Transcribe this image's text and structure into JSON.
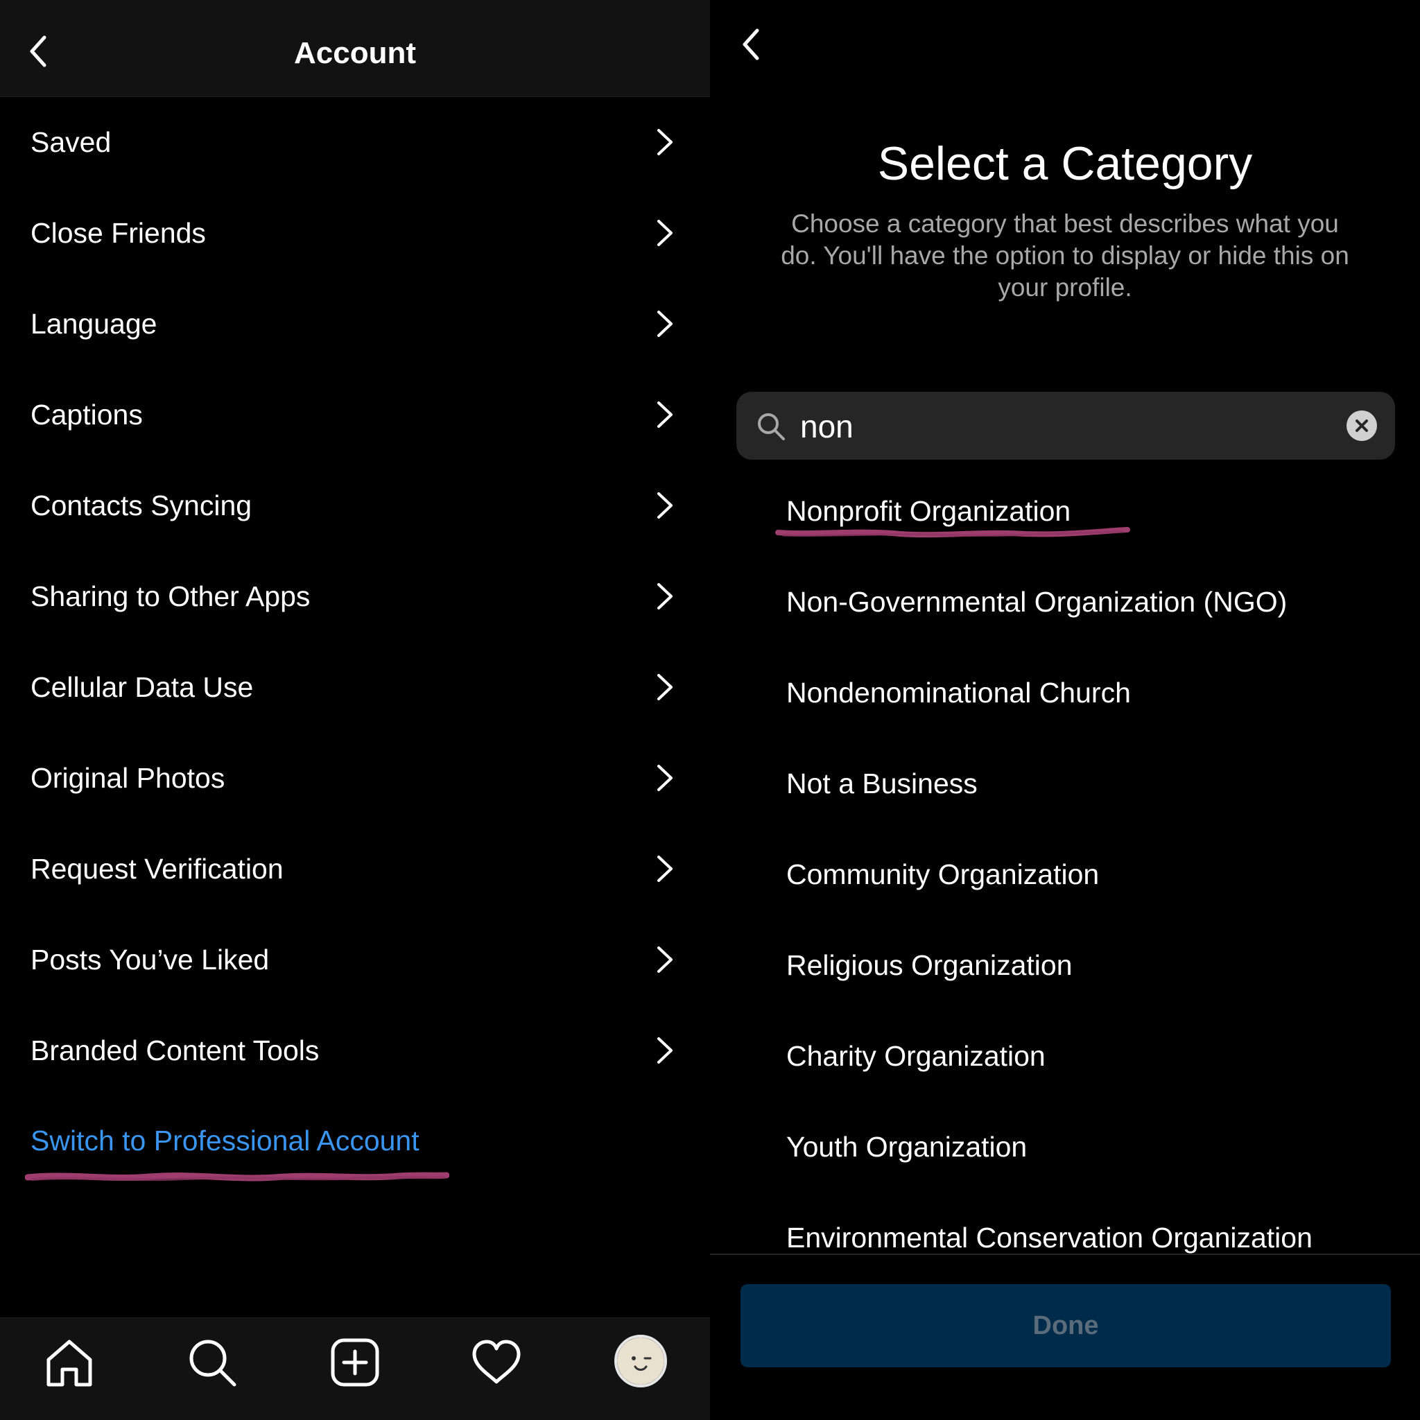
{
  "left": {
    "header": {
      "title": "Account"
    },
    "menu": [
      {
        "label": "Saved"
      },
      {
        "label": "Close Friends"
      },
      {
        "label": "Language"
      },
      {
        "label": "Captions"
      },
      {
        "label": "Contacts Syncing"
      },
      {
        "label": "Sharing to Other Apps"
      },
      {
        "label": "Cellular Data Use"
      },
      {
        "label": "Original Photos"
      },
      {
        "label": "Request Verification"
      },
      {
        "label": "Posts You’ve Liked"
      },
      {
        "label": "Branded Content Tools"
      }
    ],
    "pro_link": "Switch to Professional Account",
    "tabs": [
      "home-icon",
      "search-icon",
      "new-post-icon",
      "activity-heart-icon",
      "profile-avatar"
    ]
  },
  "right": {
    "title": "Select a Category",
    "description": "Choose a category that best describes what you do. You'll have the option to display or hide this on your profile.",
    "search": {
      "value": "non"
    },
    "results": [
      {
        "label": "Nonprofit Organization"
      },
      {
        "label": "Non-Governmental Organization (NGO)"
      },
      {
        "label": "Nondenominational Church"
      },
      {
        "label": "Not a Business"
      },
      {
        "label": "Community Organization"
      },
      {
        "label": "Religious Organization"
      },
      {
        "label": "Charity Organization"
      },
      {
        "label": "Youth Organization"
      },
      {
        "label": "Environmental Conservation Organization"
      }
    ],
    "done_label": "Done"
  },
  "colors": {
    "background": "#000000",
    "header": "#121212",
    "link": "#3a95f0",
    "annotation": "#b0457a",
    "done_bg": "#002b4a",
    "done_text": "#5a6b7a"
  }
}
